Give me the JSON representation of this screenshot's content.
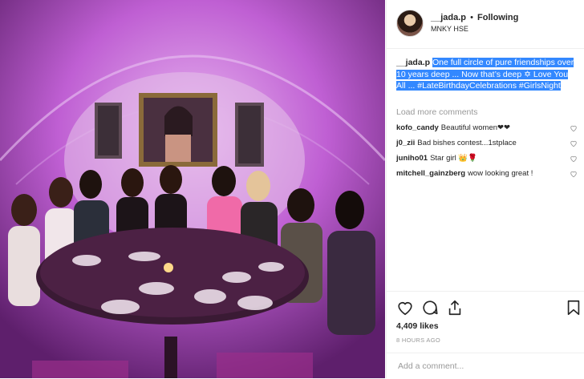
{
  "post": {
    "photo_alt": "",
    "author": "__jada.p",
    "follow_status": "Following",
    "separator": "•",
    "location": "MNKY HSE",
    "caption_user": "__jada.p",
    "caption_text": "One full circle of pure friendships over 10 years deep ... Now that’s deep ✡ Love You All ... #LateBirthdayCelebrations #GirlsNight",
    "load_more": "Load more comments",
    "comments": [
      {
        "user": "kofo_candy",
        "text": "Beautiful women❤❤"
      },
      {
        "user": "j0_zii",
        "text": "Bad bishes contest...1stplace"
      },
      {
        "user": "juniho01",
        "text": "Star girl 👑🌹"
      },
      {
        "user": "mitchell_gainzberg",
        "text": "wow looking great !"
      }
    ],
    "likes": "4,409 likes",
    "timestamp": "8 HOURS AGO",
    "add_comment_placeholder": "Add a comment..."
  },
  "icons": {
    "like": "heart-icon",
    "comment": "comment-icon",
    "share": "share-icon",
    "save": "bookmark-icon"
  },
  "colors": {
    "selection": "#3388ff",
    "muted": "#999999",
    "text": "#262626"
  }
}
